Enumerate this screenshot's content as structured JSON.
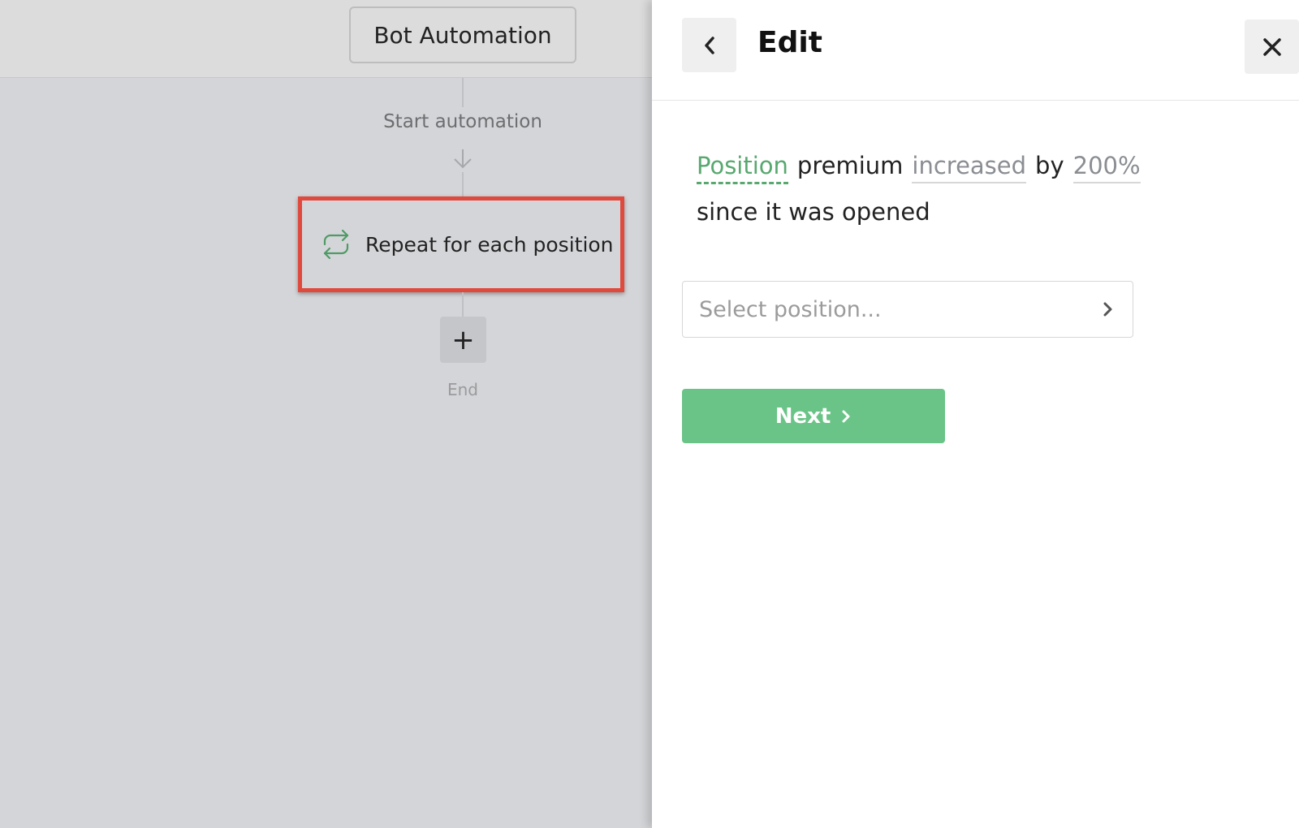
{
  "canvas": {
    "title_button": "Bot Automation",
    "start_label": "Start automation",
    "step": {
      "label": "Repeat for each position",
      "icon": "loop-icon",
      "highlight_color": "#e0493d"
    },
    "add_symbol": "+",
    "end_label": "End"
  },
  "panel": {
    "title": "Edit",
    "back_icon": "chevron-left-icon",
    "close_icon": "close-icon",
    "sentence": {
      "subject": "Position",
      "word_premium": "premium",
      "direction": "increased",
      "word_by": "by",
      "amount": "200%",
      "tail": "since it was opened"
    },
    "select": {
      "placeholder": "Select position..."
    },
    "next_button": "Next"
  },
  "colors": {
    "accent_green": "#6bc487",
    "token_green": "#58a86f",
    "token_gray": "#8a8d92"
  }
}
